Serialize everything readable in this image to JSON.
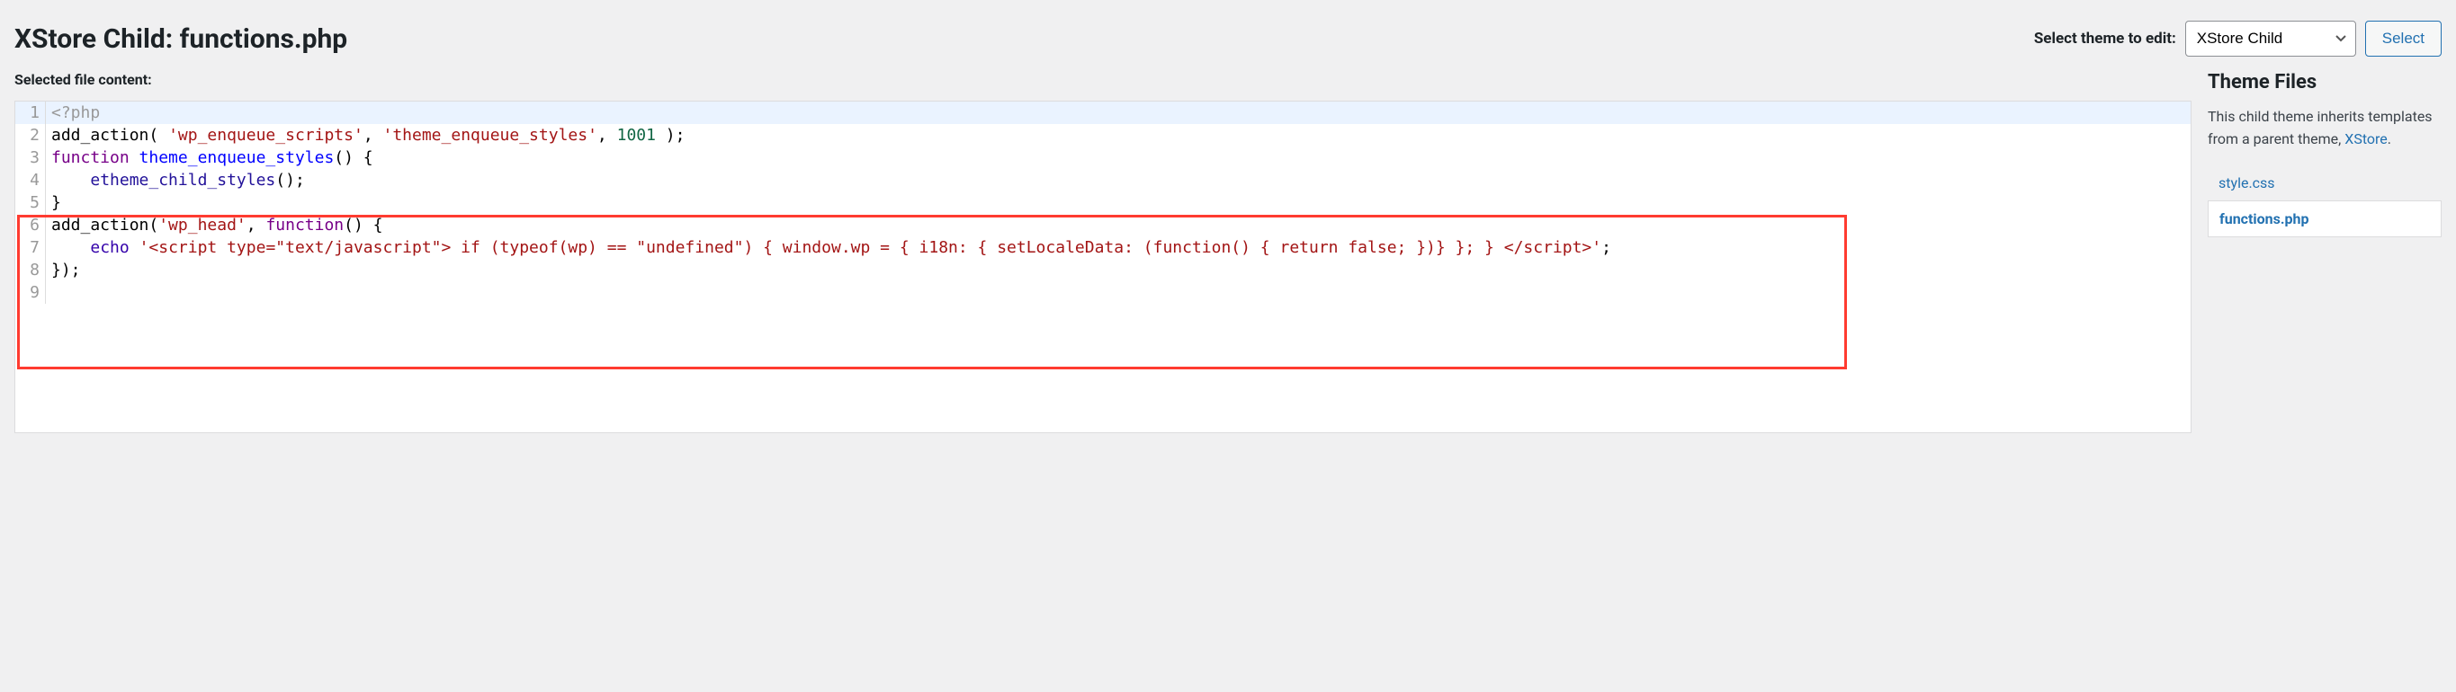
{
  "page_title": "XStore Child: functions.php",
  "theme_select": {
    "label": "Select theme to edit:",
    "options": [
      "XStore Child"
    ],
    "selected": "XStore Child",
    "button": "Select"
  },
  "editor": {
    "subhead": "Selected file content:",
    "lines": [
      {
        "n": 1,
        "active": true,
        "tokens": [
          {
            "t": "<?php",
            "c": "tok-meta"
          }
        ]
      },
      {
        "n": 2,
        "tokens": [
          {
            "t": "add_action",
            "c": "tok-fn"
          },
          {
            "t": "( ",
            "c": "tok-punc"
          },
          {
            "t": "'wp_enqueue_scripts'",
            "c": "tok-str"
          },
          {
            "t": ", ",
            "c": "tok-punc"
          },
          {
            "t": "'theme_enqueue_styles'",
            "c": "tok-str"
          },
          {
            "t": ", ",
            "c": "tok-punc"
          },
          {
            "t": "1001",
            "c": "tok-num"
          },
          {
            "t": " );",
            "c": "tok-punc"
          }
        ]
      },
      {
        "n": 3,
        "tokens": [
          {
            "t": "function",
            "c": "tok-kw"
          },
          {
            "t": " ",
            "c": ""
          },
          {
            "t": "theme_enqueue_styles",
            "c": "tok-def"
          },
          {
            "t": "() {",
            "c": "tok-punc"
          }
        ]
      },
      {
        "n": 4,
        "tokens": [
          {
            "t": "    ",
            "c": ""
          },
          {
            "t": "etheme_child_styles",
            "c": "tok-var"
          },
          {
            "t": "();",
            "c": "tok-punc"
          }
        ]
      },
      {
        "n": 5,
        "tokens": [
          {
            "t": "}",
            "c": "tok-punc"
          }
        ]
      },
      {
        "n": 6,
        "tokens": [
          {
            "t": "add_action",
            "c": "tok-fn"
          },
          {
            "t": "(",
            "c": "tok-punc"
          },
          {
            "t": "'wp_head'",
            "c": "tok-str"
          },
          {
            "t": ", ",
            "c": "tok-punc"
          },
          {
            "t": "function",
            "c": "tok-kw"
          },
          {
            "t": "() {",
            "c": "tok-punc"
          }
        ]
      },
      {
        "n": 7,
        "tokens": [
          {
            "t": "    ",
            "c": ""
          },
          {
            "t": "echo",
            "c": "tok-builtin"
          },
          {
            "t": " ",
            "c": ""
          },
          {
            "t": "'<script type=\"text/javascript\"> if (typeof(wp) == \"undefined\") { window.wp = { i18n: { setLocaleData: (function() { return false; })} }; } </scr",
            "c": "tok-str"
          },
          {
            "t": "ipt>'",
            "c": "tok-str"
          },
          {
            "t": ";",
            "c": "tok-punc"
          }
        ]
      },
      {
        "n": 8,
        "tokens": [
          {
            "t": "});",
            "c": "tok-punc"
          }
        ]
      },
      {
        "n": 9,
        "tokens": [
          {
            "t": "",
            "c": ""
          }
        ]
      }
    ]
  },
  "sidebar": {
    "heading": "Theme Files",
    "inherit_prefix": "This child theme inherits templates from a parent theme, ",
    "parent_theme": "XStore",
    "inherit_suffix": ".",
    "files": [
      {
        "name": "style.css",
        "current": false
      },
      {
        "name": "functions.php",
        "current": true
      }
    ]
  }
}
